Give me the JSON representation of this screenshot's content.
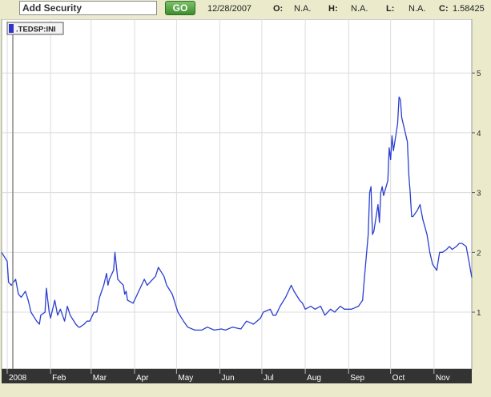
{
  "toolbar": {
    "search_value": "Add Security",
    "go_label": "GO",
    "date": "12/28/2007",
    "open_label": "O:",
    "open_value": "N.A.",
    "high_label": "H:",
    "high_value": "N.A.",
    "low_label": "L:",
    "low_value": "N.A.",
    "close_label": "C:",
    "close_value": "1.58425"
  },
  "legend": {
    "label": ".TEDSP:INI",
    "swatch_color": "#3333cc"
  },
  "colors": {
    "line": "#2b3fcf",
    "grid": "#dcdcdc",
    "plot_bg": "#ffffff",
    "panel_bg": "#ebebcc"
  },
  "chart_data": {
    "type": "line",
    "title": "",
    "xlabel": "",
    "ylabel": "",
    "ylim": [
      0.05,
      5.9
    ],
    "yticks": [
      1,
      2,
      3,
      4,
      5
    ],
    "ytick_labels": [
      "1",
      "2",
      "3",
      "4",
      "5"
    ],
    "xlim": [
      "2007-12-28",
      "2008-11-28"
    ],
    "xticks": [
      "2008-01-01",
      "2008-02-01",
      "2008-03-01",
      "2008-04-01",
      "2008-05-01",
      "2008-06-01",
      "2008-07-01",
      "2008-08-01",
      "2008-09-01",
      "2008-10-01",
      "2008-11-01"
    ],
    "xtick_labels": [
      "2008",
      "Feb",
      "Mar",
      "Apr",
      "May",
      "Jun",
      "Jul",
      "Aug",
      "Sep",
      "Oct",
      "Nov"
    ],
    "grid": true,
    "legend_position": "top-left",
    "series": [
      {
        "name": ".TEDSP:INI",
        "x": [
          "2007-12-28",
          "2008-01-01",
          "2008-01-02",
          "2008-01-04",
          "2008-01-07",
          "2008-01-09",
          "2008-01-11",
          "2008-01-14",
          "2008-01-16",
          "2008-01-18",
          "2008-01-22",
          "2008-01-24",
          "2008-01-25",
          "2008-01-28",
          "2008-01-29",
          "2008-01-31",
          "2008-02-01",
          "2008-02-04",
          "2008-02-06",
          "2008-02-08",
          "2008-02-11",
          "2008-02-13",
          "2008-02-15",
          "2008-02-19",
          "2008-02-21",
          "2008-02-22",
          "2008-02-25",
          "2008-02-27",
          "2008-02-29",
          "2008-03-03",
          "2008-03-05",
          "2008-03-07",
          "2008-03-10",
          "2008-03-12",
          "2008-03-13",
          "2008-03-14",
          "2008-03-17",
          "2008-03-18",
          "2008-03-20",
          "2008-03-24",
          "2008-03-25",
          "2008-03-26",
          "2008-03-27",
          "2008-03-31",
          "2008-04-02",
          "2008-04-04",
          "2008-04-08",
          "2008-04-10",
          "2008-04-14",
          "2008-04-16",
          "2008-04-18",
          "2008-04-22",
          "2008-04-24",
          "2008-04-28",
          "2008-04-30",
          "2008-05-02",
          "2008-05-06",
          "2008-05-09",
          "2008-05-14",
          "2008-05-19",
          "2008-05-23",
          "2008-05-28",
          "2008-06-02",
          "2008-06-05",
          "2008-06-10",
          "2008-06-16",
          "2008-06-20",
          "2008-06-25",
          "2008-06-30",
          "2008-07-02",
          "2008-07-07",
          "2008-07-09",
          "2008-07-11",
          "2008-07-14",
          "2008-07-18",
          "2008-07-22",
          "2008-07-24",
          "2008-07-28",
          "2008-07-30",
          "2008-08-01",
          "2008-08-05",
          "2008-08-08",
          "2008-08-12",
          "2008-08-15",
          "2008-08-19",
          "2008-08-22",
          "2008-08-26",
          "2008-08-29",
          "2008-09-03",
          "2008-09-08",
          "2008-09-11",
          "2008-09-12",
          "2008-09-15",
          "2008-09-16",
          "2008-09-17",
          "2008-09-18",
          "2008-09-19",
          "2008-09-22",
          "2008-09-23",
          "2008-09-24",
          "2008-09-25",
          "2008-09-26",
          "2008-09-29",
          "2008-09-30",
          "2008-10-01",
          "2008-10-02",
          "2008-10-03",
          "2008-10-06",
          "2008-10-07",
          "2008-10-08",
          "2008-10-09",
          "2008-10-10",
          "2008-10-13",
          "2008-10-14",
          "2008-10-15",
          "2008-10-16",
          "2008-10-17",
          "2008-10-20",
          "2008-10-22",
          "2008-10-24",
          "2008-10-27",
          "2008-10-29",
          "2008-10-31",
          "2008-11-03",
          "2008-11-05",
          "2008-11-07",
          "2008-11-10",
          "2008-11-12",
          "2008-11-14",
          "2008-11-17",
          "2008-11-19",
          "2008-11-21",
          "2008-11-24",
          "2008-11-26",
          "2008-11-28"
        ],
        "y": [
          2.0,
          1.85,
          1.5,
          1.45,
          1.55,
          1.3,
          1.25,
          1.35,
          1.2,
          1.0,
          0.85,
          0.8,
          0.95,
          1.0,
          1.4,
          1.0,
          0.9,
          1.2,
          0.95,
          1.05,
          0.85,
          1.1,
          0.95,
          0.8,
          0.75,
          0.75,
          0.8,
          0.85,
          0.85,
          1.0,
          1.0,
          1.25,
          1.45,
          1.65,
          1.45,
          1.55,
          1.7,
          2.0,
          1.55,
          1.45,
          1.3,
          1.35,
          1.2,
          1.15,
          1.25,
          1.35,
          1.55,
          1.45,
          1.55,
          1.6,
          1.75,
          1.6,
          1.45,
          1.3,
          1.15,
          1.0,
          0.85,
          0.75,
          0.7,
          0.7,
          0.75,
          0.7,
          0.72,
          0.7,
          0.75,
          0.72,
          0.85,
          0.8,
          0.9,
          1.0,
          1.05,
          0.95,
          0.95,
          1.1,
          1.25,
          1.45,
          1.35,
          1.2,
          1.15,
          1.05,
          1.1,
          1.05,
          1.1,
          0.95,
          1.05,
          1.0,
          1.1,
          1.05,
          1.05,
          1.1,
          1.2,
          1.5,
          2.3,
          3.0,
          3.1,
          2.3,
          2.35,
          2.8,
          2.5,
          3.0,
          3.1,
          2.95,
          3.2,
          3.75,
          3.55,
          3.95,
          3.7,
          4.15,
          4.6,
          4.55,
          4.25,
          4.15,
          3.85,
          3.3,
          3.0,
          2.6,
          2.6,
          2.7,
          2.8,
          2.55,
          2.3,
          2.0,
          1.8,
          1.7,
          2.0,
          2.0,
          2.05,
          2.1,
          2.05,
          2.1,
          2.15,
          2.15,
          2.1,
          1.85,
          1.58
        ]
      }
    ]
  }
}
